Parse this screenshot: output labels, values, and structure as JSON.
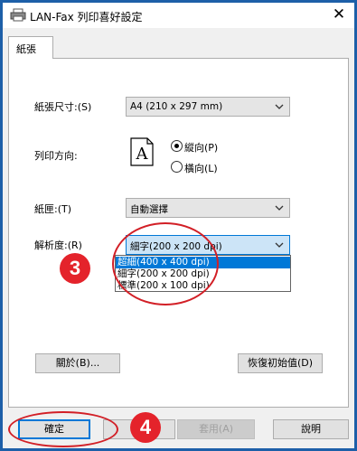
{
  "window": {
    "title": "LAN-Fax 列印喜好設定",
    "close_glyph": "✕"
  },
  "tabs": [
    {
      "label": "紙張",
      "active": true
    }
  ],
  "paper_size": {
    "label": "紙張尺寸:(S)",
    "value": "A4 (210 x 297 mm)"
  },
  "orientation": {
    "label": "列印方向:",
    "preview_letter": "A",
    "options": [
      {
        "label": "縱向(P)",
        "selected": true
      },
      {
        "label": "橫向(L)",
        "selected": false
      }
    ]
  },
  "tray": {
    "label": "紙匣:(T)",
    "value": "自動選擇"
  },
  "resolution": {
    "label": "解析度:(R)",
    "value": "細字(200 x 200 dpi)",
    "options": [
      {
        "label": "超細(400 x 400 dpi)",
        "highlighted": true
      },
      {
        "label": "細字(200 x 200 dpi)",
        "highlighted": false
      },
      {
        "label": "標準(200 x 100 dpi)",
        "highlighted": false
      }
    ]
  },
  "buttons": {
    "about": "關於(B)...",
    "restore_defaults": "恢復初始值(D)",
    "ok": "確定",
    "cancel": "",
    "apply": "套用(A)",
    "help": "說明"
  },
  "annotations": {
    "step3": "3",
    "step4": "4",
    "color": "#e4232b"
  },
  "colors": {
    "frame": "#1d5fa8",
    "selection": "#0078d7"
  }
}
